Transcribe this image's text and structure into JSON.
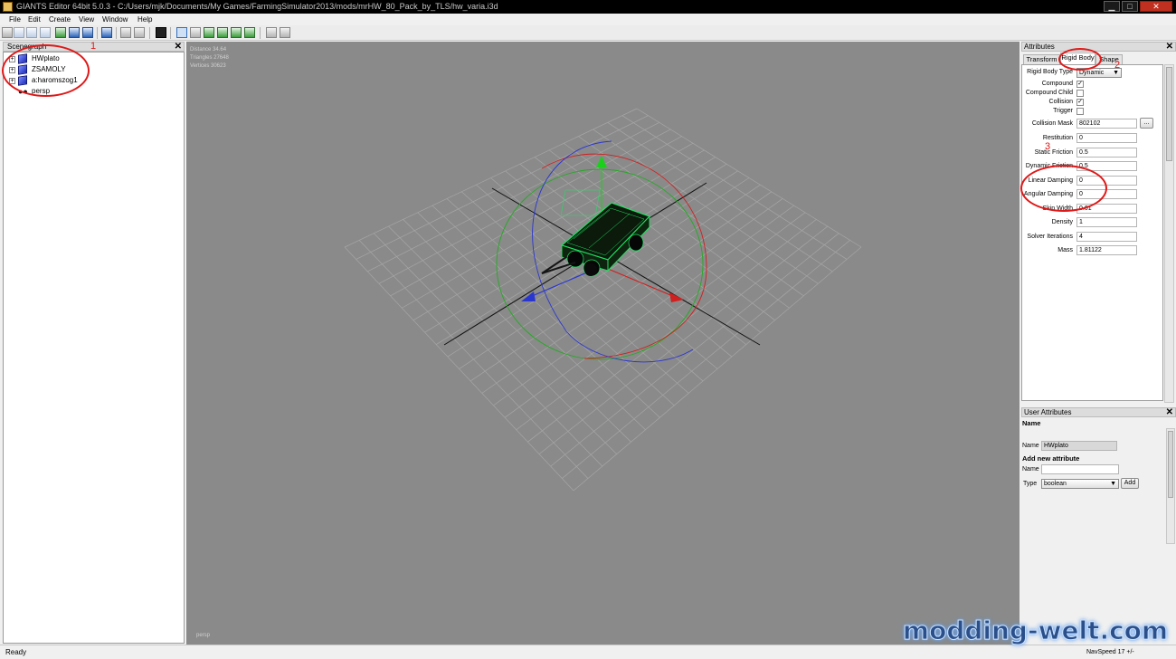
{
  "window": {
    "title": "GIANTS Editor 64bit 5.0.3 - C:/Users/mjk/Documents/My Games/FarmingSimulator2013/mods/mrHW_80_Pack_by_TLS/hw_varia.i3d",
    "minimize": "▁",
    "maximize": "□",
    "close": "✕"
  },
  "menu": [
    "File",
    "Edit",
    "Create",
    "View",
    "Window",
    "Help"
  ],
  "toolbar": {
    "icons": [
      "new-file-icon",
      "open-file-icon",
      "open-folder-icon",
      "refresh-icon",
      "save-icon",
      "save-as-icon",
      "import-icon",
      "undo-icon",
      "redo-icon",
      "play-icon",
      "select-tool-icon",
      "magnet-icon",
      "terrain-sculpt-icon",
      "terrain-paint-icon",
      "foliage-paint-icon",
      "plant-icon",
      "settings-icon",
      "settings-alt-icon"
    ]
  },
  "scenegraph": {
    "title": "Scenegraph",
    "close": "✕",
    "nodes": [
      {
        "label": "HWplato",
        "type": "transform",
        "expander": "+"
      },
      {
        "label": "ZSAMOLY",
        "type": "transform",
        "expander": "+"
      },
      {
        "label": "a:haromszog1",
        "type": "transform",
        "expander": "+"
      },
      {
        "label": "persp",
        "type": "camera",
        "expander": ""
      }
    ]
  },
  "viewport": {
    "stats": [
      "Distance 34.64",
      "Triangles 27648",
      "Vertices 30623"
    ],
    "camera_label": "persp"
  },
  "attributes": {
    "title": "Attributes",
    "close": "✕",
    "tabs": [
      "Transform",
      "Rigid Body",
      "Shape"
    ],
    "active_tab": "Rigid Body",
    "rigid_body_type": {
      "label": "Rigid Body Type",
      "value": "Dynamic"
    },
    "checkboxes": [
      {
        "label": "Compound",
        "checked": "✓"
      },
      {
        "label": "Compound Child",
        "checked": ""
      },
      {
        "label": "Collision",
        "checked": "✓"
      },
      {
        "label": "Trigger",
        "checked": ""
      }
    ],
    "collision_mask": {
      "label": "Collision Mask",
      "value": "802102",
      "button": "..."
    },
    "fields": [
      {
        "label": "Restitution",
        "value": "0"
      },
      {
        "label": "Static Friction",
        "value": "0.5"
      },
      {
        "label": "Dynamic Friction",
        "value": "0.5"
      },
      {
        "label": "Linear Damping",
        "value": "0"
      },
      {
        "label": "Angular Damping",
        "value": "0"
      },
      {
        "label": "Skin Width",
        "value": "0.01"
      },
      {
        "label": "Density",
        "value": "1"
      },
      {
        "label": "Solver Iterations",
        "value": "4"
      },
      {
        "label": "Mass",
        "value": "1.81122"
      }
    ]
  },
  "user_attributes": {
    "title": "User Attributes",
    "close": "✕",
    "name_heading": "Name",
    "name_label": "Name",
    "name_value": "HWplato",
    "add_heading": "Add new attribute",
    "add_name_label": "Name",
    "add_name_value": "",
    "type_label": "Type",
    "type_value": "boolean",
    "add_button": "Add"
  },
  "status": {
    "text": "Ready",
    "navspeed": "NavSpeed 17 +/-"
  },
  "watermark": "modding-welt.com",
  "annotations": [
    "1",
    "2",
    "3"
  ],
  "colors": {
    "viewport_bg": "#8a8a8a",
    "grid": "#a8a8a8",
    "selection": "#20e060",
    "annotation": "#e01818",
    "node_icon": "#1b2bb8"
  }
}
